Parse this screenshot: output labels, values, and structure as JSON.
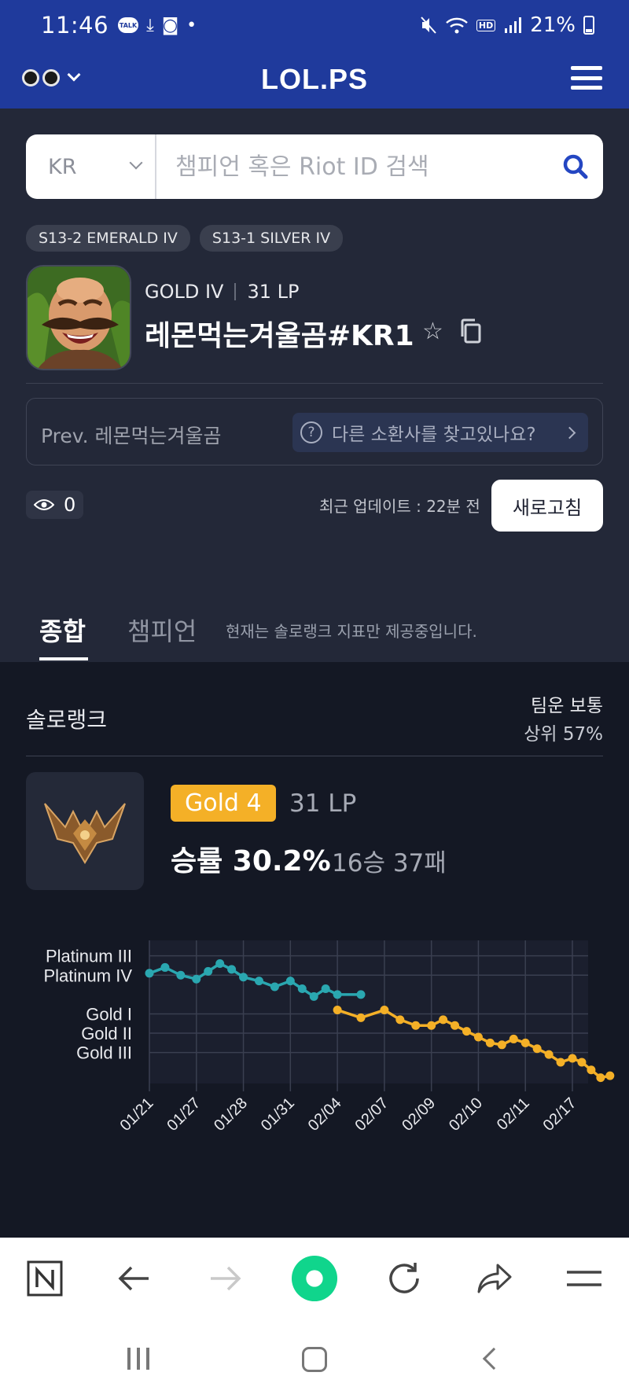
{
  "status_bar": {
    "time": "11:46",
    "talk_badge": "TALK",
    "battery": "21%",
    "hd_voice": "HD"
  },
  "header": {
    "logo": "LOL.PS"
  },
  "search": {
    "region": "KR",
    "placeholder": "챔피언 혹은 Riot ID 검색"
  },
  "seasons": [
    "S13-2 EMERALD IV",
    "S13-1 SILVER IV"
  ],
  "profile": {
    "tier": "GOLD IV",
    "lp": "31 LP",
    "name": "레몬먹는겨울곰#KR1",
    "prev_name": "Prev. 레몬먹는겨울곰",
    "find_prompt": "다른 소환사를 찾고있나요?",
    "views": "0",
    "updated": "최근 업데이트 : 22분 전",
    "refresh_label": "새로고침"
  },
  "tabs": {
    "overview": "종합",
    "champion": "챔피언",
    "note": "현재는 솔로랭크 지표만 제공중입니다."
  },
  "solo_rank": {
    "title": "솔로랭크",
    "team_luck": "팀운 보통",
    "team_rank": "상위 57%",
    "rank_badge": "Gold 4",
    "lp": "31 LP",
    "winrate_label": "승률 30.2%",
    "record": "16승 37패"
  },
  "colors": {
    "header_blue": "#1f3a9c",
    "panel": "#232838",
    "dark_panel": "#141824",
    "platinum_series": "#2aa7b0",
    "gold_series": "#f4b027",
    "search_icon": "#2446c2"
  },
  "chart_data": {
    "type": "line",
    "y_ticks": [
      "Platinum III",
      "Platinum IV",
      "Gold I",
      "Gold II",
      "Gold III"
    ],
    "x_ticks": [
      "01/21",
      "01/27",
      "01/28",
      "01/31",
      "02/04",
      "02/07",
      "02/09",
      "02/10",
      "02/11",
      "02/17"
    ],
    "ylabel": "",
    "xlabel": "",
    "y_unit": "tier rank",
    "series": [
      {
        "color": "#2aa7b0",
        "values": [
          [
            "01/21",
            2.1
          ],
          [
            "01/21",
            2.4
          ],
          [
            "01/21",
            2.0
          ],
          [
            "01/27",
            1.8
          ],
          [
            "01/27",
            2.2
          ],
          [
            "01/27",
            2.6
          ],
          [
            "01/27",
            2.3
          ],
          [
            "01/28",
            1.9
          ],
          [
            "01/28",
            1.7
          ],
          [
            "01/28",
            1.4
          ],
          [
            "01/31",
            1.7
          ],
          [
            "01/31",
            1.3
          ],
          [
            "01/31",
            0.9
          ],
          [
            "01/31",
            1.3
          ],
          [
            "02/04",
            1.0
          ],
          [
            "02/04",
            1.0
          ]
        ]
      },
      {
        "color": "#f4b027",
        "values": [
          [
            "02/04",
            0.2
          ],
          [
            "02/04",
            -0.2
          ],
          [
            "02/07",
            0.2
          ],
          [
            "02/07",
            -0.3
          ],
          [
            "02/07",
            -0.6
          ],
          [
            "02/09",
            -0.6
          ],
          [
            "02/09",
            -0.3
          ],
          [
            "02/09",
            -0.6
          ],
          [
            "02/09",
            -0.9
          ],
          [
            "02/10",
            -1.2
          ],
          [
            "02/10",
            -1.5
          ],
          [
            "02/10",
            -1.6
          ],
          [
            "02/10",
            -1.3
          ],
          [
            "02/11",
            -1.5
          ],
          [
            "02/11",
            -1.8
          ],
          [
            "02/11",
            -2.1
          ],
          [
            "02/11",
            -2.5
          ],
          [
            "02/17",
            -2.3
          ],
          [
            "02/17",
            -2.5
          ],
          [
            "02/17",
            -2.9
          ],
          [
            "02/17",
            -3.3
          ],
          [
            "02/17",
            -3.2
          ]
        ]
      }
    ]
  }
}
